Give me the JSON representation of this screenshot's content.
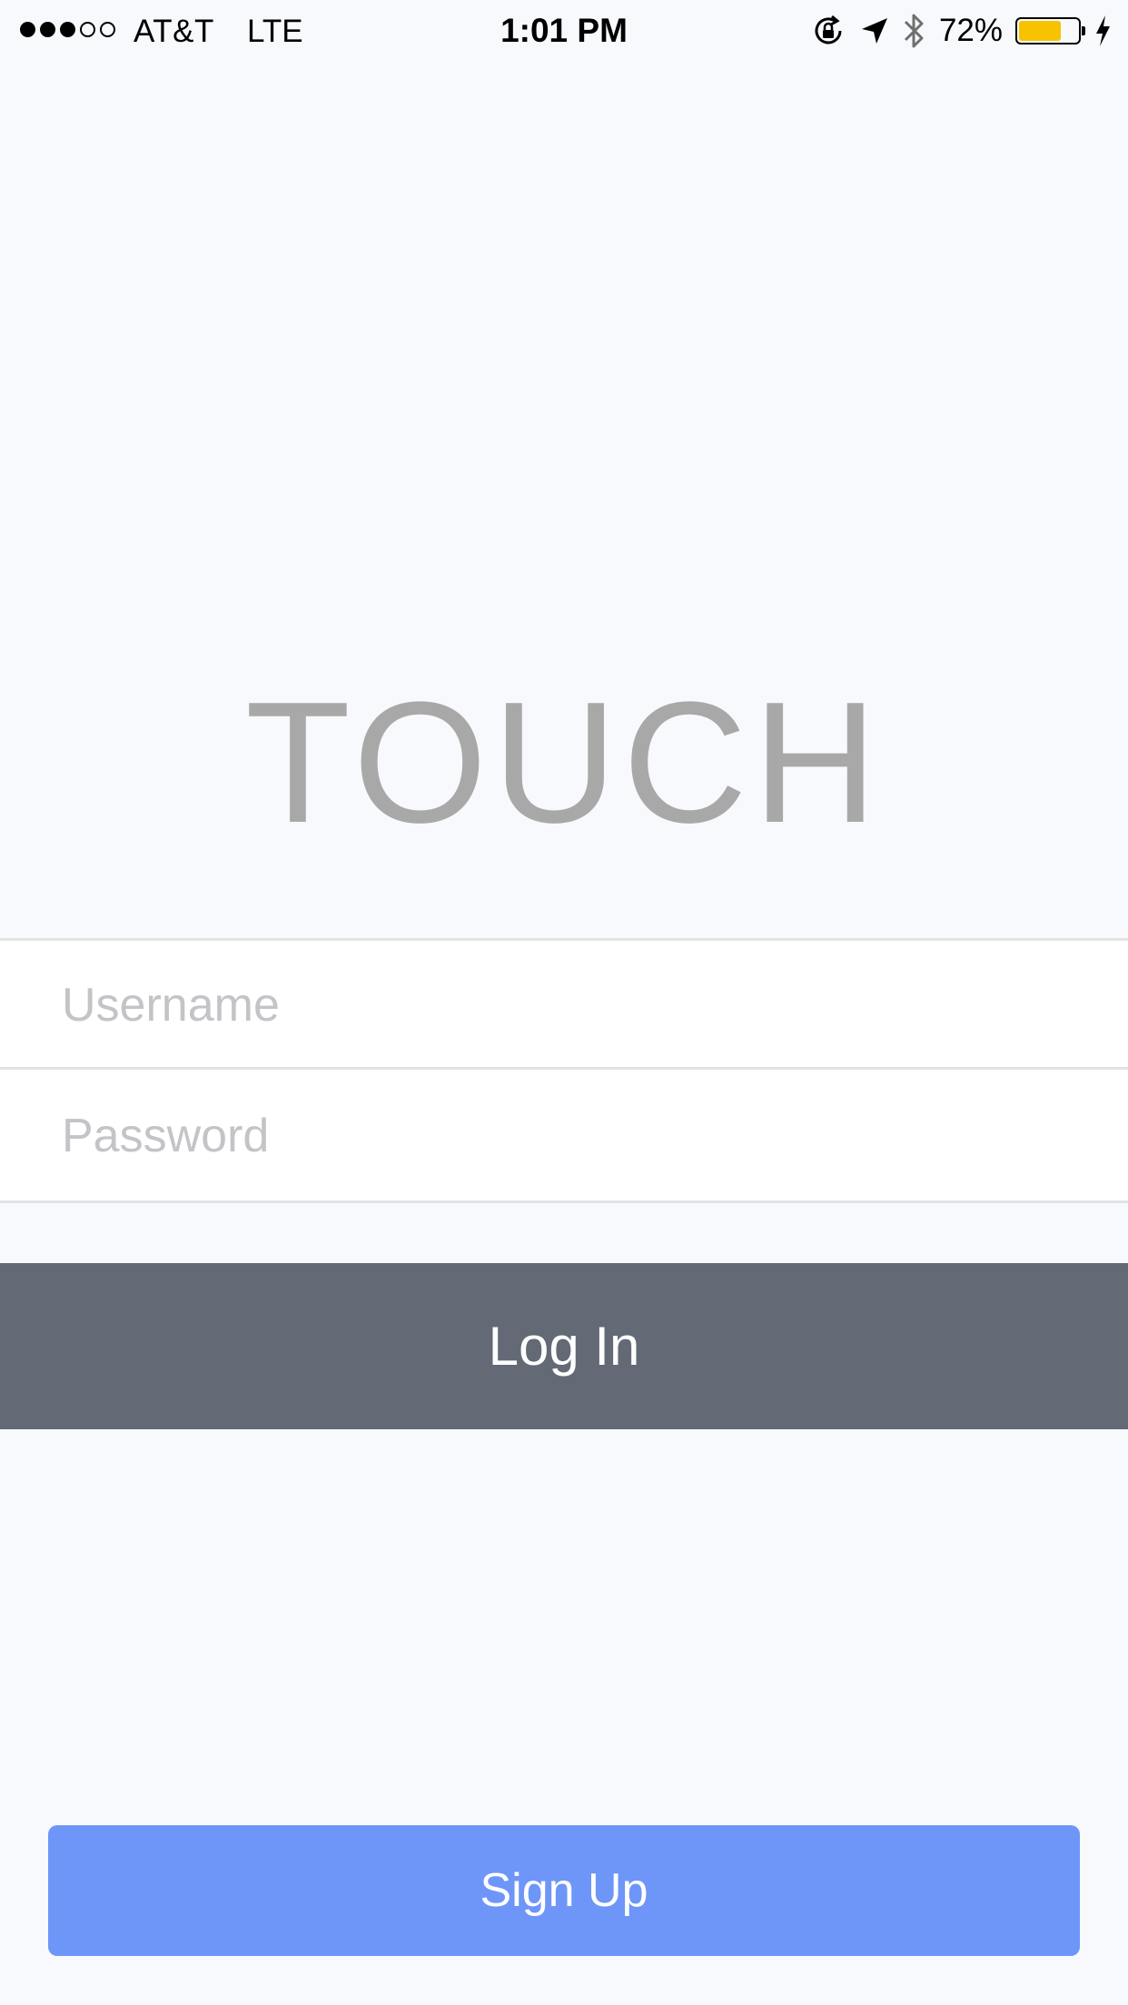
{
  "status_bar": {
    "signal_bars_filled": 3,
    "signal_bars_total": 5,
    "carrier": "AT&T",
    "network": "LTE",
    "time": "1:01 PM",
    "battery_percent": "72%",
    "battery_level": 0.72,
    "battery_color": "#f7c300",
    "icons": [
      "orientation-lock-icon",
      "location-arrow-icon",
      "bluetooth-icon",
      "battery-icon",
      "charging-bolt-icon"
    ]
  },
  "app": {
    "logo_text": "TOUCH",
    "logo_color": "#a8a8a8"
  },
  "login_form": {
    "username_placeholder": "Username",
    "username_value": "",
    "password_placeholder": "Password",
    "password_value": "",
    "login_label": "Log In",
    "login_color": "#636a76"
  },
  "signup": {
    "label": "Sign Up",
    "color": "#6e96f9"
  }
}
